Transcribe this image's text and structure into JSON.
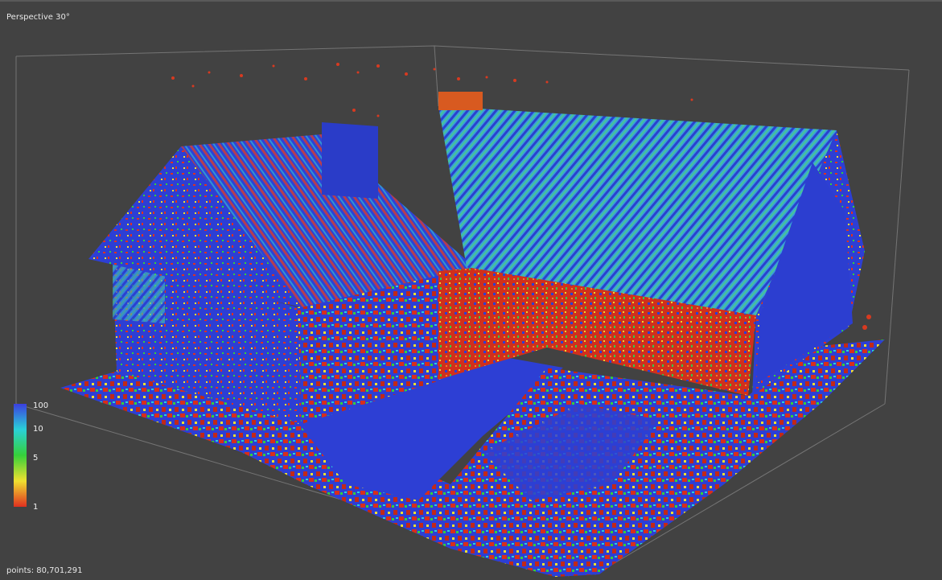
{
  "view": {
    "mode_label": "Perspective 30°"
  },
  "status": {
    "points_label": "points: 80,701,291"
  },
  "legend": {
    "ticks": [
      "100",
      "10",
      "5",
      "1"
    ],
    "colors": [
      "#3b3fe0",
      "#2ad0d8",
      "#35d03a",
      "#f0e030",
      "#e03020"
    ]
  },
  "colors": {
    "background": "#424242",
    "bbox_line": "#8a8a8a",
    "high_density": "#2d3fd4",
    "mid_density": "#2fd07a",
    "low_density": "#e02a1a"
  }
}
